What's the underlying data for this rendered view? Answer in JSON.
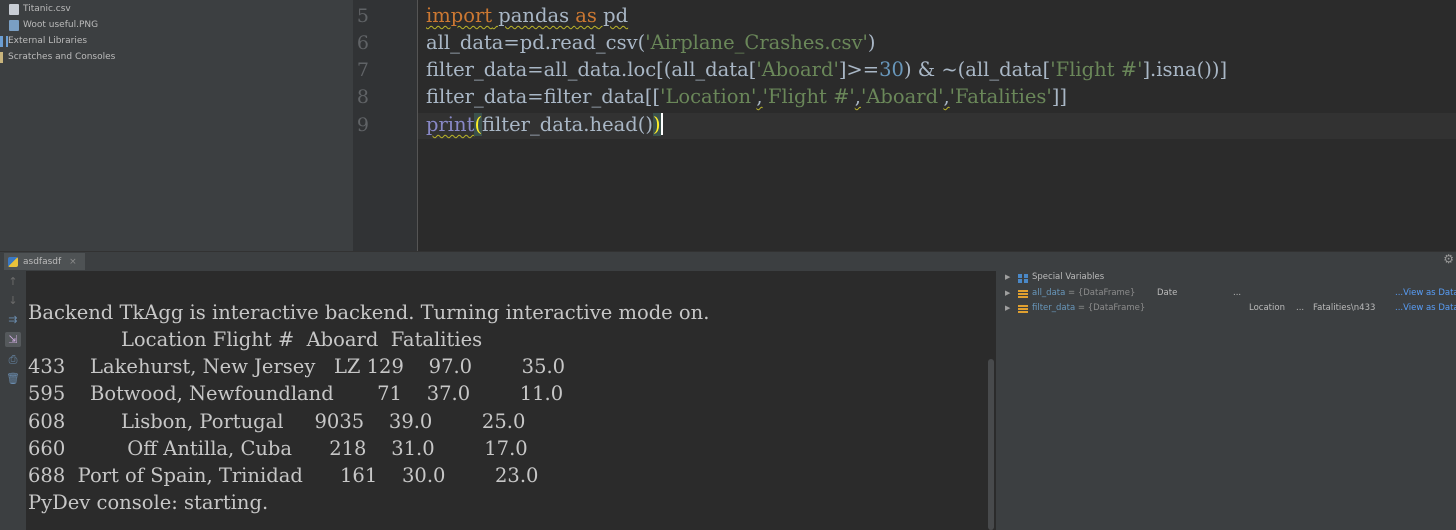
{
  "project_tree": {
    "items": [
      {
        "label": "Titanic.csv",
        "icon": "csv-file-icon"
      },
      {
        "label": "Woot useful.PNG",
        "icon": "image-file-icon"
      },
      {
        "label": "External Libraries",
        "icon": "library-icon"
      },
      {
        "label": "Scratches and Consoles",
        "icon": "scratches-icon"
      }
    ]
  },
  "editor": {
    "line_numbers": [
      "5",
      "6",
      "7",
      "8",
      "9"
    ],
    "code_line_1": {
      "kw_import": "import",
      "mod": " pandas ",
      "kw_as": "as",
      "alias": " pd"
    },
    "code_line_2": {
      "a": "all_data=pd.read_csv(",
      "s": "'Airplane_Crashes.csv'",
      "b": ")"
    },
    "code_line_3": {
      "a": "filter_data=all_data.loc[(all_data[",
      "s1": "'Aboard'",
      "b": "]>=",
      "n": "30",
      "c": ") & ~(all_data[",
      "s2": "'Flight #'",
      "d": "].isna())]"
    },
    "code_line_4": {
      "a": "filter_data=filter_data[[",
      "s1": "'Location'",
      "c1": ",",
      "s2": "'Flight #'",
      "c2": ",",
      "s3": "'Aboard'",
      "c3": ",",
      "s4": "'Fatalities'",
      "b": "]]"
    },
    "code_line_5": {
      "fn": "print",
      "open": "(",
      "a": "filter_data.head()",
      "close": ")"
    }
  },
  "tool_window": {
    "tab_label": "asdfasdf",
    "close_glyph": "×"
  },
  "console": {
    "lines": [
      "Backend TkAgg is interactive backend. Turning interactive mode on.",
      "               Location Flight #  Aboard  Fatalities",
      "433    Lakehurst, New Jersey   LZ 129    97.0        35.0",
      "595    Botwood, Newfoundland       71    37.0        11.0",
      "608         Lisbon, Portugal     9035    39.0        25.0",
      "660          Off Antilla, Cuba      218    31.0        17.0",
      "688  Port of Spain, Trinidad      161    30.0        23.0",
      "PyDev console: starting."
    ]
  },
  "variables": {
    "special": "Special Variables",
    "all_data": {
      "name": "all_data",
      "type": " = {DataFrame}",
      "preview": "Date",
      "ellipsis": "...",
      "link": "...View as Data"
    },
    "filter_data": {
      "name": "filter_data",
      "type": " = {DataFrame}",
      "preview_a": "Location",
      "preview_b": "...",
      "preview_c": "Fatalities\\n433",
      "link": "...View as Data"
    }
  },
  "colors": {
    "keyword": "#cc7832",
    "string": "#6a8759",
    "number": "#6897bb",
    "builtin": "#8888c6",
    "link": "#589df6"
  }
}
